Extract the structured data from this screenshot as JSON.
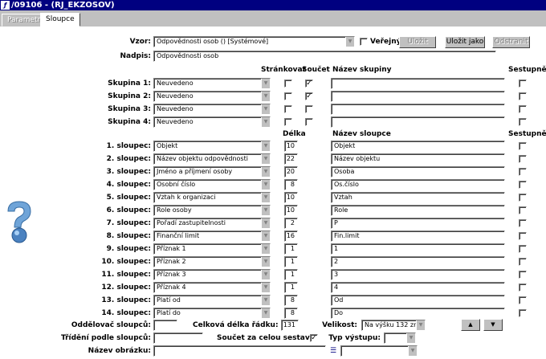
{
  "window": {
    "title": "/09106 - (RJ_EKZOSOV)"
  },
  "tabs": [
    "Parametry",
    "Sloupce"
  ],
  "form": {
    "vzor_label": "Vzor:",
    "vzor_value": "Odpovědnosti osob   ()   [Systémové]",
    "verejny_label": "Veřejný",
    "btn_ulozit": "Uložit",
    "btn_ulozit_jako": "Uložit jako",
    "btn_odstranit": "Odstranit",
    "nadpis_label": "Nadpis:",
    "nadpis_value": "Odpovědnosti osob"
  },
  "group_headers": {
    "strankovat": "Stránkovat",
    "soucet": "Součet",
    "nazev_skupiny": "Název skupiny",
    "sestupne": "Sestupně"
  },
  "groups": [
    {
      "label": "Skupina 1:",
      "value": "Neuvedeno",
      "strankovat": false,
      "soucet": true,
      "nazev": "",
      "sestupne": false
    },
    {
      "label": "Skupina 2:",
      "value": "Neuvedeno",
      "strankovat": false,
      "soucet": true,
      "nazev": "",
      "sestupne": false
    },
    {
      "label": "Skupina 3:",
      "value": "Neuvedeno",
      "strankovat": false,
      "soucet": false,
      "nazev": "",
      "sestupne": false
    },
    {
      "label": "Skupina 4:",
      "value": "Neuvedeno",
      "strankovat": false,
      "soucet": false,
      "nazev": "",
      "sestupne": false
    }
  ],
  "column_headers": {
    "delka": "Délka",
    "nazev_sloupce": "Název sloupce",
    "sestupne": "Sestupně"
  },
  "columns": [
    {
      "label": "1. sloupec:",
      "value": "Objekt",
      "delka": "10",
      "nazev": "Objekt"
    },
    {
      "label": "2. sloupec:",
      "value": "Název objektu odpovědnosti",
      "delka": "22",
      "nazev": "Název objektu"
    },
    {
      "label": "3. sloupec:",
      "value": "Jméno a příjmení osoby",
      "delka": "20",
      "nazev": "Osoba"
    },
    {
      "label": "4. sloupec:",
      "value": "Osobní číslo",
      "delka": "8",
      "nazev": "Os.číslo"
    },
    {
      "label": "5. sloupec:",
      "value": "Vztah k organizaci",
      "delka": "10",
      "nazev": "Vztah"
    },
    {
      "label": "6. sloupec:",
      "value": "Role osoby",
      "delka": "10",
      "nazev": "Role"
    },
    {
      "label": "7. sloupec:",
      "value": "Pořadí zastupitelnosti",
      "delka": "2",
      "nazev": "P"
    },
    {
      "label": "8. sloupec:",
      "value": "Finanční limit",
      "delka": "16",
      "nazev": "Fin.limit"
    },
    {
      "label": "9. sloupec:",
      "value": "Příznak 1",
      "delka": "1",
      "nazev": "1"
    },
    {
      "label": "10. sloupec:",
      "value": "Příznak 2",
      "delka": "1",
      "nazev": "2"
    },
    {
      "label": "11. sloupec:",
      "value": "Příznak 3",
      "delka": "1",
      "nazev": "3"
    },
    {
      "label": "12. sloupec:",
      "value": "Příznak 4",
      "delka": "1",
      "nazev": "4"
    },
    {
      "label": "13. sloupec:",
      "value": "Platí od",
      "delka": "8",
      "nazev": "Od"
    },
    {
      "label": "14. sloupec:",
      "value": "Platí do",
      "delka": "8",
      "nazev": "Do"
    }
  ],
  "footer": {
    "oddelovac_label": "Oddělovač sloupců:",
    "oddelovac_value": "",
    "celkova_label": "Celková délka řádku:",
    "celkova_value": "131",
    "velikost_label": "Velikost:",
    "velikost_value": "Na výšku 132 zn.",
    "trideni_label": "Třídění podle sloupců:",
    "trideni_value": "",
    "soucet_label": "Součet za celou sestavu:",
    "typ_label": "Typ výstupu:",
    "typ_value": "",
    "obrazek_label": "Název obrázku:",
    "obrazek_value": ""
  }
}
